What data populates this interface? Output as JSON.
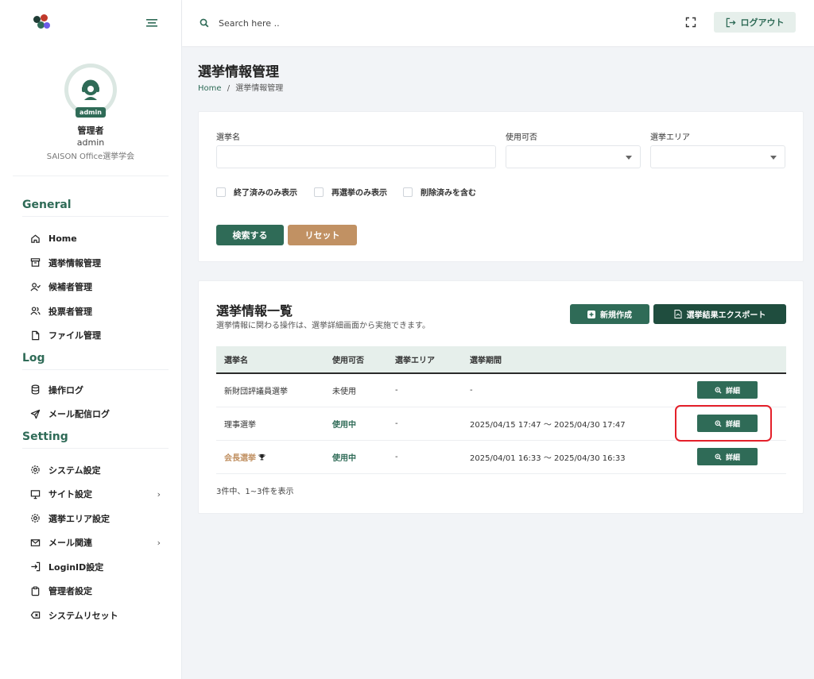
{
  "header": {
    "search_placeholder": "Search here ..",
    "logout_label": "ログアウト"
  },
  "profile": {
    "badge": "admin",
    "name": "管理者",
    "login_id": "admin",
    "org": "SAISON Office選挙学会"
  },
  "sidebar": {
    "sections": [
      {
        "title": "General",
        "items": [
          {
            "label": "Home",
            "icon": "home-icon"
          },
          {
            "label": "選挙情報管理",
            "icon": "archive-icon"
          },
          {
            "label": "候補者管理",
            "icon": "user-check-icon"
          },
          {
            "label": "投票者管理",
            "icon": "users-icon"
          },
          {
            "label": "ファイル管理",
            "icon": "file-icon"
          }
        ]
      },
      {
        "title": "Log",
        "items": [
          {
            "label": "操作ログ",
            "icon": "database-icon"
          },
          {
            "label": "メール配信ログ",
            "icon": "send-icon"
          }
        ]
      },
      {
        "title": "Setting",
        "items": [
          {
            "label": "システム設定",
            "icon": "gear-icon"
          },
          {
            "label": "サイト設定",
            "icon": "monitor-icon",
            "submenu": true
          },
          {
            "label": "選挙エリア設定",
            "icon": "gear-icon"
          },
          {
            "label": "メール関連",
            "icon": "mail-icon",
            "submenu": true
          },
          {
            "label": "LoginID設定",
            "icon": "login-icon"
          },
          {
            "label": "管理者設定",
            "icon": "clipboard-icon"
          },
          {
            "label": "システムリセット",
            "icon": "delete-icon"
          }
        ]
      }
    ]
  },
  "page": {
    "title": "選挙情報管理",
    "breadcrumb_home": "Home",
    "breadcrumb_sep": "/",
    "breadcrumb_current": "選挙情報管理"
  },
  "filter": {
    "name_label": "選挙名",
    "name_value": "",
    "usable_label": "使用可否",
    "usable_value": "",
    "area_label": "選挙エリア",
    "area_value": "",
    "checkbox_finished": "終了済みのみ表示",
    "checkbox_reelection": "再選挙のみ表示",
    "checkbox_deleted": "削除済みを含む",
    "search_button": "検索する",
    "reset_button": "リセット"
  },
  "list": {
    "title": "選挙情報一覧",
    "subtitle": "選挙情報に関わる操作は、選挙詳細画面から実施できます。",
    "new_button": "新規作成",
    "export_button": "選挙結果エクスポート",
    "columns": [
      "選挙名",
      "使用可否",
      "選挙エリア",
      "選挙期間"
    ],
    "rows": [
      {
        "name": "新財団評議員選挙",
        "status": "未使用",
        "status_active": false,
        "area": "-",
        "period": "-",
        "detail": "詳細"
      },
      {
        "name": "理事選挙",
        "status": "使用中",
        "status_active": true,
        "area": "-",
        "period": "2025/04/15 17:47 〜 2025/04/30 17:47",
        "detail": "詳細"
      },
      {
        "name": "会長選挙",
        "status": "使用中",
        "status_active": true,
        "area": "-",
        "period": "2025/04/01 16:33 〜 2025/04/30 16:33",
        "detail": "詳細",
        "highlight_name": true,
        "trophy": true
      }
    ],
    "count_text": "3件中、1~3件を表示"
  },
  "colors": {
    "primary": "#2f6b57",
    "dark": "#1f4d3e",
    "accent": "#c19163",
    "highlight_box": "#e4202a"
  }
}
